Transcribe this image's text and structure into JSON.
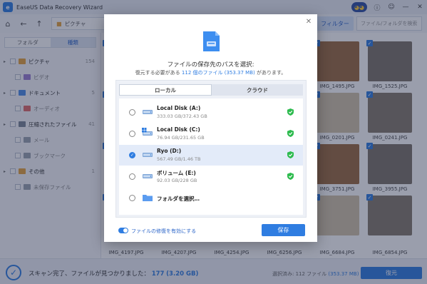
{
  "app": {
    "title": "EaseUS Data Recovery Wizard"
  },
  "titlebar_icons": [
    "owl-icon",
    "info-icon",
    "user-icon",
    "minimize-icon",
    "close-icon"
  ],
  "toolbar": {
    "breadcrumb": "ピクチャ",
    "filter_label": "フィルター",
    "search_placeholder": "ファイル/フォルダを検索"
  },
  "sidebar": {
    "tabs": [
      "フォルダ",
      "種類"
    ],
    "active_tab": "種類",
    "items": [
      {
        "label": "ピクチャ",
        "count": "154",
        "level": 0,
        "icon_color": "#e6a23c"
      },
      {
        "label": "ビデオ",
        "count": "",
        "level": 1,
        "icon_color": "#9b7fd1"
      },
      {
        "label": "ドキュメント",
        "count": "5",
        "level": 0,
        "icon_color": "#4b8ce8"
      },
      {
        "label": "オーディオ",
        "count": "",
        "level": 1,
        "icon_color": "#e06b6b"
      },
      {
        "label": "圧縮されたファイル",
        "count": "41",
        "level": 0,
        "icon_color": "#7a8595"
      },
      {
        "label": "メール",
        "count": "",
        "level": 1,
        "icon_color": "#9aa3b0"
      },
      {
        "label": "ブックマーク",
        "count": "",
        "level": 1,
        "icon_color": "#9aa3b0"
      },
      {
        "label": "その他",
        "count": "1",
        "level": 0,
        "icon_color": "#e6a23c"
      },
      {
        "label": "未保存ファイル",
        "count": "",
        "level": 1,
        "icon_color": "#9aa3b0"
      }
    ]
  },
  "grid": {
    "names": [
      "IMG_1495.JPG",
      "IMG_1525.JPG",
      "IMG_0201.JPG",
      "IMG_0241.JPG",
      "IMG_3751.JPG",
      "IMG_3955.JPG",
      "IMG_4197.JPG",
      "IMG_4207.JPG",
      "IMG_4254.JPG",
      "IMG_6256.JPG",
      "IMG_6684.JPG",
      "IMG_6854.JPG"
    ]
  },
  "status": {
    "text": "スキャン完了、ファイルが見つかりました：",
    "count": "177",
    "size": "(3.20 GB)",
    "selected_label": "選択済み: 112 ファイル",
    "selected_size": "(353.37 MB)",
    "recover_label": "復元"
  },
  "modal": {
    "title": "ファイルの保存先のパスを選択:",
    "subtitle_pre": "復元する必要がある",
    "subtitle_count": "112 個のファイル (353.37 MB)",
    "subtitle_post": "があります。",
    "tabs": [
      "ローカル",
      "クラウド"
    ],
    "active_tab": "ローカル",
    "drives": [
      {
        "name": "Local Disk (A:)",
        "size": "333.03 GB/372.43 GB",
        "selected": false,
        "icon": "drive-icon",
        "healthy": true
      },
      {
        "name": "Local Disk (C:)",
        "size": "76.94 GB/231.65 GB",
        "selected": false,
        "icon": "windows-drive-icon",
        "healthy": true
      },
      {
        "name": "Ryo (D:)",
        "size": "567.49 GB/1.46 TB",
        "selected": true,
        "icon": "drive-icon",
        "healthy": true
      },
      {
        "name": "ボリューム (E:)",
        "size": "92.03 GB/228 GB",
        "selected": false,
        "icon": "drive-icon",
        "healthy": true
      },
      {
        "name": "フォルダを選択…",
        "size": "",
        "selected": false,
        "icon": "folder-icon",
        "healthy": false
      }
    ],
    "toggle_label": "ファイルの修復を有効にする",
    "toggle_on": true,
    "save_label": "保存"
  }
}
